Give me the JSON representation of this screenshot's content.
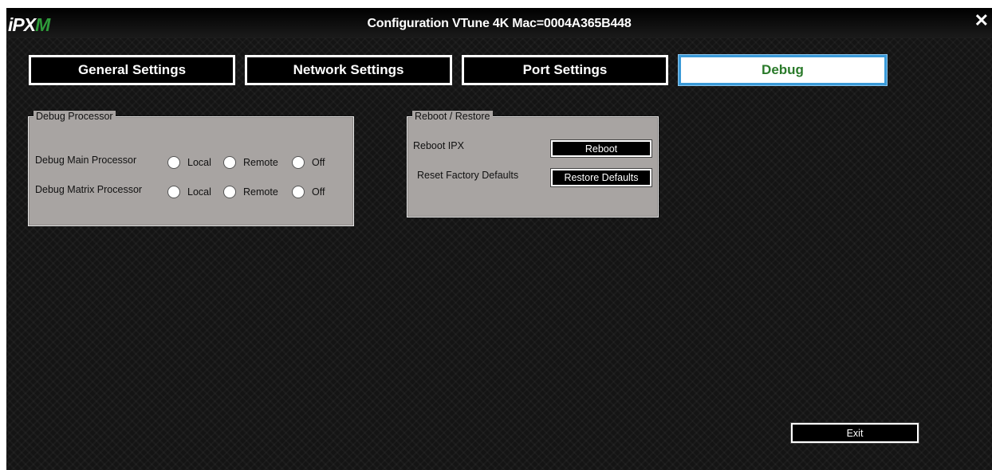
{
  "window": {
    "logo_prefix": "iPX",
    "logo_accent": "M",
    "title": "Configuration VTune 4K Mac=0004A365B448",
    "close_glyph": "✕"
  },
  "tabs": [
    {
      "label": "General Settings",
      "active": false
    },
    {
      "label": "Network Settings",
      "active": false
    },
    {
      "label": "Port Settings",
      "active": false
    },
    {
      "label": "Debug",
      "active": true
    }
  ],
  "debug_processor": {
    "legend": "Debug Processor",
    "rows": [
      {
        "label": "Debug Main Processor",
        "options": [
          "Local",
          "Remote",
          "Off"
        ]
      },
      {
        "label": "Debug Matrix Processor",
        "options": [
          "Local",
          "Remote",
          "Off"
        ]
      }
    ]
  },
  "reboot_restore": {
    "legend": "Reboot / Restore",
    "reboot_label": "Reboot  IPX",
    "reboot_button": "Reboot",
    "reset_label": "Reset Factory Defaults",
    "restore_button": "Restore Defaults"
  },
  "exit_button": "Exit",
  "colors": {
    "background": "#141414",
    "panel": "#a8a4a2",
    "active_tab_text": "#2a7a2a",
    "active_tab_border": "#3a9ad8",
    "logo_accent": "#2e9b3a"
  }
}
